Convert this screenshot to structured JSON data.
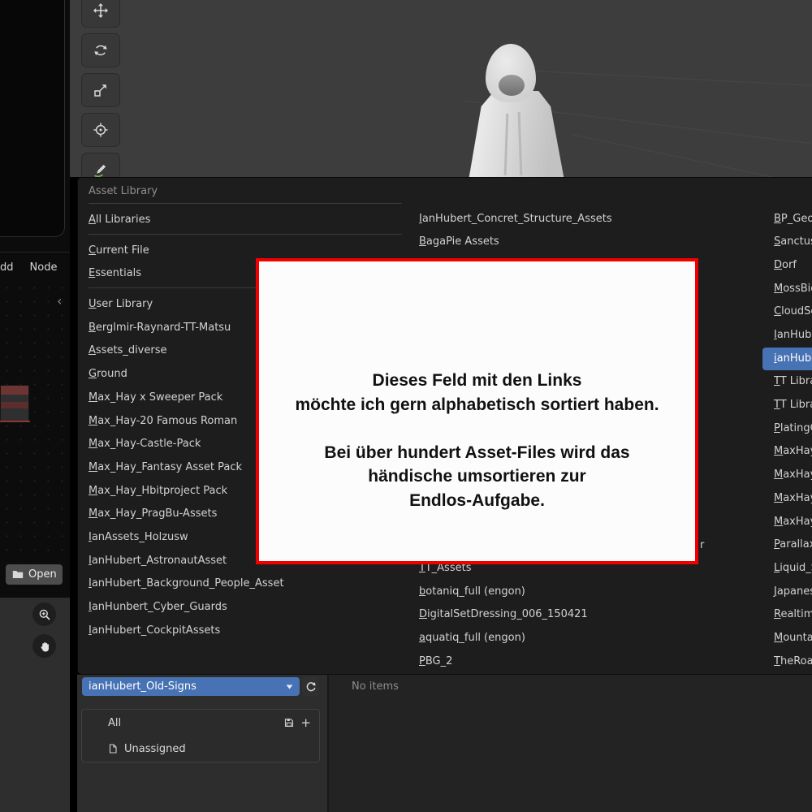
{
  "viewport": {
    "tools": [
      "move",
      "rotate",
      "scale",
      "transform",
      "annotate"
    ]
  },
  "node_editor": {
    "header_menu_clipped": "dd",
    "header_menu_node": "Node",
    "open_button_label": "Open"
  },
  "asset_library_menu": {
    "title": "Asset Library",
    "section_all": [
      "All Libraries"
    ],
    "section_file": [
      "Current File",
      "Essentials"
    ],
    "section_user": [
      "User Library",
      "Berglmir-Raynard-TT-Matsu",
      "Assets_diverse",
      "Ground",
      "Max_Hay x Sweeper Pack",
      "Max_Hay-20 Famous Roman",
      "Max_Hay-Castle-Pack",
      "Max_Hay_Fantasy Asset Pack",
      "Max_Hay_Hbitproject Pack",
      "Max_Hay_PragBu-Assets",
      "IanAssets_Holzusw",
      "IanHubert_AstronautAsset",
      "IanHubert_Background_People_Asset",
      "IanHunbert_Cyber_Guards",
      "IanHubert_CockpitAssets"
    ],
    "column2": [
      "IanHubert_Concret_Structure_Assets",
      "BagaPie Assets",
      "",
      "",
      "",
      "",
      "",
      "",
      "",
      "",
      "",
      "",
      "",
      "",
      "",
      "TT_Assets",
      "botaniq_full (engon)",
      "DigitalSetDressing_006_150421",
      "aquatiq_full (engon)",
      "PBG_2"
    ],
    "column2_clipped_fragment": "r",
    "column3": [
      {
        "label": "BP_Geo"
      },
      {
        "label": "Sanctus"
      },
      {
        "label": "Dorf"
      },
      {
        "label": "MossBio"
      },
      {
        "label": "CloudSc"
      },
      {
        "label": "IanHube"
      },
      {
        "label": "ianHube",
        "selected": true
      },
      {
        "label": "TT Libra"
      },
      {
        "label": "TT Libra"
      },
      {
        "label": "PlatingG"
      },
      {
        "label": "MaxHay"
      },
      {
        "label": "MaxHay"
      },
      {
        "label": "MaxHay"
      },
      {
        "label": "MaxHay"
      },
      {
        "label": "Parallax"
      },
      {
        "label": "Liquid_S"
      },
      {
        "label": "Japanes"
      },
      {
        "label": "Realtime"
      },
      {
        "label": "Mountai"
      },
      {
        "label": "TheRoa"
      }
    ]
  },
  "annotation": {
    "lines": [
      "Dieses Feld mit den Links",
      "möchte ich gern alphabetisch sortiert haben.",
      "",
      "Bei über hundert Asset-Files wird das",
      "händische umsortieren zur",
      "Endlos-Aufgabe."
    ]
  },
  "asset_browser": {
    "library_selector_value": "ianHubert_Old-Signs",
    "status_text": "No items",
    "catalog_all_label": "All",
    "catalog_unassigned_label": "Unassigned"
  },
  "colors": {
    "accent_blue": "#4772b3",
    "annotation_border_red": "#f20000",
    "menu_background": "#1d1d1d"
  }
}
